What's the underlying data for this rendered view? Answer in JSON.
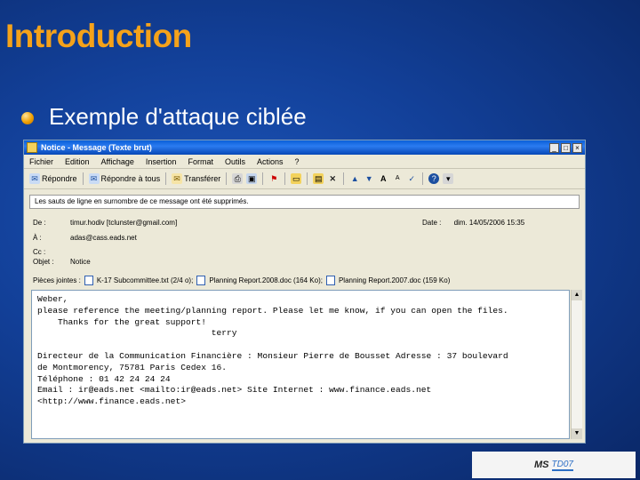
{
  "slide": {
    "title": "Introduction",
    "bullet": "Exemple d'attaque ciblée"
  },
  "window": {
    "title": "Notice - Message (Texte brut)",
    "controls": [
      "_",
      "□",
      "×"
    ]
  },
  "menu": [
    "Fichier",
    "Edition",
    "Affichage",
    "Insertion",
    "Format",
    "Outils",
    "Actions",
    "?"
  ],
  "toolbar": {
    "reply": "Répondre",
    "reply_all": "Répondre à tous",
    "forward": "Transférer"
  },
  "infobar": "Les sauts de ligne en surnombre de ce message ont été supprimés.",
  "headers": {
    "from_label": "De :",
    "from_value": "timur.hodiv [tclunster@gmail.com]",
    "date_label": "Date :",
    "date_value": "dim. 14/05/2006 15:35",
    "to_label": "À :",
    "to_value": "adas@cass.eads.net",
    "cc_label": "Cc :",
    "cc_value": "",
    "subject_label": "Objet :",
    "subject_value": "Notice",
    "attach_label": "Pièces jointes :",
    "attachments": [
      "K-17 Subcommittee.txt (2/4 o);",
      "Planning Report.2008.doc (164 Ko);",
      "Planning Report.2007.doc (159 Ko)"
    ]
  },
  "body": {
    "lines": [
      "Weber,",
      "please reference the meeting/planning report. Please let me know, if you can open the files.",
      "    Thanks for the great support!",
      "                                  terry",
      "",
      "Directeur de la Communication Financière : Monsieur Pierre de Bousset Adresse : 37 boulevard",
      "de Montmorency, 75781 Paris Cedex 16.",
      "Téléphone : 01 42 24 24 24",
      "Email : ir@eads.net <mailto:ir@eads.net> Site Internet : www.finance.eads.net",
      "<http://www.finance.eads.net>"
    ]
  },
  "logo": {
    "ms": "MS",
    "td": "TD07"
  },
  "colors": {
    "title": "#f5a21a",
    "background": "#123f97"
  },
  "icons": [
    "reply-icon",
    "reply-all-icon",
    "forward-icon",
    "print-icon",
    "save-icon",
    "flag-icon",
    "move-icon",
    "delete-icon",
    "up-arrow-icon",
    "down-arrow-icon",
    "font-icon",
    "help-icon"
  ]
}
